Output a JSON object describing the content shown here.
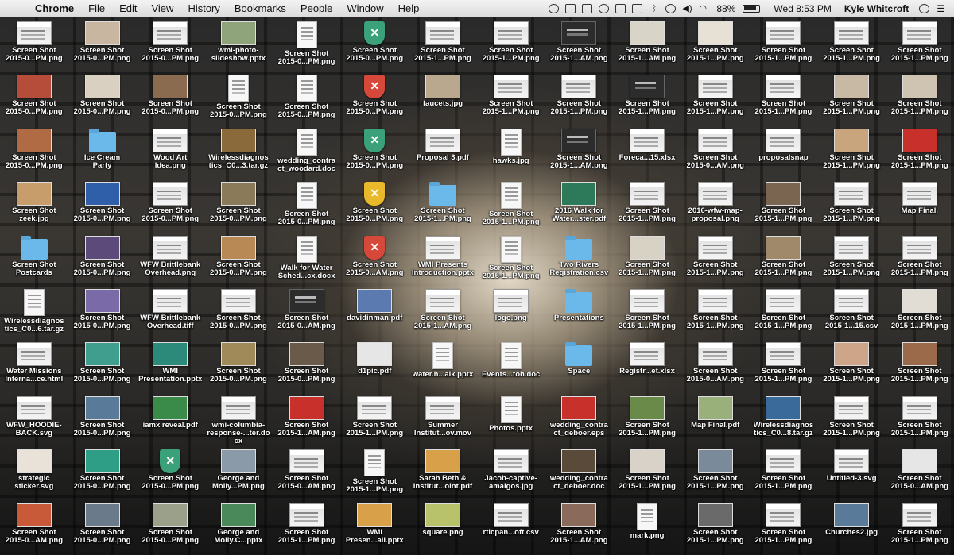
{
  "menubar": {
    "app_name": "Chrome",
    "menus": [
      "File",
      "Edit",
      "View",
      "History",
      "Bookmarks",
      "People",
      "Window",
      "Help"
    ],
    "battery": "88%",
    "clock": "Wed 8:53 PM",
    "user": "Kyle Whitcroft"
  },
  "desktop": {
    "rows": [
      [
        {
          "n1": "Screen Shot",
          "n2": "2015-0...PM.png",
          "t": "ss"
        },
        {
          "n1": "Screen Shot",
          "n2": "2015-0...PM.png",
          "t": "photo",
          "c": "#c9b6a0"
        },
        {
          "n1": "Screen Shot",
          "n2": "2015-0...PM.png",
          "t": "ss"
        },
        {
          "n1": "wmi-photo-",
          "n2": "slideshow.pptx",
          "t": "photo",
          "c": "#8fa47a"
        },
        {
          "n1": "Screen Shot",
          "n2": "2015-0...PM.png",
          "t": "doc"
        },
        {
          "n1": "Screen Shot",
          "n2": "2015-0...PM.png",
          "t": "shield",
          "c": "#3aa17a"
        },
        {
          "n1": "Screen Shot",
          "n2": "2015-1...PM.png",
          "t": "ss"
        },
        {
          "n1": "Screen Shot",
          "n2": "2015-1...PM.png",
          "t": "ss"
        },
        {
          "n1": "Screen Shot",
          "n2": "2015-1...AM.png",
          "t": "dark"
        },
        {
          "n1": "Screen Shot",
          "n2": "2015-1...AM.png",
          "t": "photo",
          "c": "#d9d4c8"
        },
        {
          "n1": "Screen Shot",
          "n2": "2015-1...PM.png",
          "t": "photo",
          "c": "#e6e0d5"
        },
        {
          "n1": "Screen Shot",
          "n2": "2015-1...PM.png",
          "t": "ss"
        },
        {
          "n1": "Screen Shot",
          "n2": "2015-1...PM.png",
          "t": "ss"
        },
        {
          "n1": "Screen Shot",
          "n2": "2015-1...PM.png",
          "t": "ss"
        }
      ],
      [
        {
          "n1": "Screen Shot",
          "n2": "2015-0...PM.png",
          "t": "photo",
          "c": "#b64c3a"
        },
        {
          "n1": "Screen Shot",
          "n2": "2015-0...PM.png",
          "t": "photo",
          "c": "#d9d0c2"
        },
        {
          "n1": "Screen Shot",
          "n2": "2015-0...PM.png",
          "t": "photo",
          "c": "#8a6b4f"
        },
        {
          "n1": "Screen Shot",
          "n2": "2015-0...PM.png",
          "t": "doc"
        },
        {
          "n1": "Screen Shot",
          "n2": "2015-0...PM.png",
          "t": "doc"
        },
        {
          "n1": "Screen Shot",
          "n2": "2015-0...PM.png",
          "t": "shield",
          "c": "#d6493a"
        },
        {
          "n1": "faucets.jpg",
          "n2": "",
          "t": "photo",
          "c": "#b9a88d"
        },
        {
          "n1": "Screen Shot",
          "n2": "2015-1...PM.png",
          "t": "ss"
        },
        {
          "n1": "Screen Shot",
          "n2": "2015-1...PM.png",
          "t": "ss"
        },
        {
          "n1": "Screen Shot",
          "n2": "2015-1...PM.png",
          "t": "dark"
        },
        {
          "n1": "Screen Shot",
          "n2": "2015-1...PM.png",
          "t": "ss"
        },
        {
          "n1": "Screen Shot",
          "n2": "2015-1...PM.png",
          "t": "ss"
        },
        {
          "n1": "Screen Shot",
          "n2": "2015-1...PM.png",
          "t": "photo",
          "c": "#c7b9a3"
        },
        {
          "n1": "Screen Shot",
          "n2": "2015-1...PM.png",
          "t": "photo",
          "c": "#cfc3b1"
        }
      ],
      [
        {
          "n1": "Screen Shot",
          "n2": "2015-0...PM.png",
          "t": "photo",
          "c": "#b06b45"
        },
        {
          "n1": "Ice Cream",
          "n2": "Party",
          "t": "folder"
        },
        {
          "n1": "Wood Art",
          "n2": "Idea.png",
          "t": "ss"
        },
        {
          "n1": "Wirelessdiagnos",
          "n2": "tics_C0...3.tar.gz",
          "t": "photo",
          "c": "#8a6a3a"
        },
        {
          "n1": "wedding_contra",
          "n2": "ct_woodard.doc",
          "t": "doc"
        },
        {
          "n1": "Screen Shot",
          "n2": "2015-0...PM.png",
          "t": "shield",
          "c": "#3aa17a"
        },
        {
          "n1": "Proposal 3.pdf",
          "n2": "",
          "t": "ss"
        },
        {
          "n1": "hawks.jpg",
          "n2": "",
          "t": "doc"
        },
        {
          "n1": "Screen Shot",
          "n2": "2015-1...AM.png",
          "t": "dark"
        },
        {
          "n1": "Foreca...15.xlsx",
          "n2": "",
          "t": "ss"
        },
        {
          "n1": "Screen Shot",
          "n2": "2015-0...AM.png",
          "t": "ss"
        },
        {
          "n1": "proposalsnap",
          "n2": "",
          "t": "ss"
        },
        {
          "n1": "Screen Shot",
          "n2": "2015-1...PM.png",
          "t": "photo",
          "c": "#c9a57e"
        },
        {
          "n1": "Screen Shot",
          "n2": "2015-1...PM.png",
          "t": "photo",
          "c": "#c8302c"
        }
      ],
      [
        {
          "n1": "Screen Shot",
          "n2": "zeek.jpg",
          "t": "photo",
          "c": "#c79d6b"
        },
        {
          "n1": "Screen Shot",
          "n2": "2015-0...PM.png",
          "t": "photo",
          "c": "#2f5fa8"
        },
        {
          "n1": "Screen Shot",
          "n2": "2015-0...PM.png",
          "t": "ss"
        },
        {
          "n1": "Screen Shot",
          "n2": "2015-0...PM.png",
          "t": "photo",
          "c": "#8a7a5a"
        },
        {
          "n1": "Screen Shot",
          "n2": "2015-0...PM.png",
          "t": "doc"
        },
        {
          "n1": "Screen Shot",
          "n2": "2015-0...PM.png",
          "t": "shield",
          "c": "#e8b92a"
        },
        {
          "n1": "Screen Shot",
          "n2": "2015-1...PM.png",
          "t": "folder"
        },
        {
          "n1": "Screen Shot",
          "n2": "2015-1...PM.png",
          "t": "doc"
        },
        {
          "n1": "2016 Walk for",
          "n2": "Water...ster.pdf",
          "t": "photo",
          "c": "#2c7a5a"
        },
        {
          "n1": "Screen Shot",
          "n2": "2015-1...PM.png",
          "t": "ss"
        },
        {
          "n1": "2016-wfw-map-",
          "n2": "proposal.png",
          "t": "ss"
        },
        {
          "n1": "Screen Shot",
          "n2": "2015-1...PM.png",
          "t": "photo",
          "c": "#7a6650"
        },
        {
          "n1": "Screen Shot",
          "n2": "2015-1...PM.png",
          "t": "ss"
        },
        {
          "n1": "Map Final.",
          "n2": "",
          "t": "ss"
        }
      ],
      [
        {
          "n1": "Screen Shot",
          "n2": "Postcards",
          "t": "folder"
        },
        {
          "n1": "Screen Shot",
          "n2": "2015-0...PM.png",
          "t": "photo",
          "c": "#5b4a7a"
        },
        {
          "n1": "WFW Brittlebank",
          "n2": "Overhead.png",
          "t": "ss"
        },
        {
          "n1": "Screen Shot",
          "n2": "2015-0...PM.png",
          "t": "photo",
          "c": "#b98955"
        },
        {
          "n1": "Walk for Water",
          "n2": "Sched...cx.docx",
          "t": "doc"
        },
        {
          "n1": "Screen Shot",
          "n2": "2015-0...AM.png",
          "t": "shield",
          "c": "#d6493a"
        },
        {
          "n1": "WMI Presents",
          "n2": "Introduction.pptx",
          "t": "ss"
        },
        {
          "n1": "Screen Shot",
          "n2": "2015-1...PM.png",
          "t": "doc"
        },
        {
          "n1": "Two Rivers",
          "n2": "Registration.csv",
          "t": "folder"
        },
        {
          "n1": "Screen Shot",
          "n2": "2015-1...PM.png",
          "t": "photo",
          "c": "#d8d2c4"
        },
        {
          "n1": "Screen Shot",
          "n2": "2015-1...PM.png",
          "t": "ss"
        },
        {
          "n1": "Screen Shot",
          "n2": "2015-1...PM.png",
          "t": "photo",
          "c": "#a0886a"
        },
        {
          "n1": "Screen Shot",
          "n2": "2015-1...PM.png",
          "t": "ss"
        },
        {
          "n1": "Screen Shot",
          "n2": "2015-1...PM.png",
          "t": "ss"
        }
      ],
      [
        {
          "n1": "Wirelessdiagnos",
          "n2": "tics_C0...6.tar.gz",
          "t": "doc"
        },
        {
          "n1": "Screen Shot",
          "n2": "2015-0...PM.png",
          "t": "photo",
          "c": "#7a6aa8"
        },
        {
          "n1": "WFW Brittlebank",
          "n2": "Overhead.tiff",
          "t": "ss"
        },
        {
          "n1": "Screen Shot",
          "n2": "2015-0...PM.png",
          "t": "ss"
        },
        {
          "n1": "Screen Shot",
          "n2": "2015-0...AM.png",
          "t": "dark"
        },
        {
          "n1": "davidinman.pdf",
          "n2": "",
          "t": "photo",
          "c": "#5a7ab0"
        },
        {
          "n1": "Screen Shot",
          "n2": "2015-1...AM.png",
          "t": "ss"
        },
        {
          "n1": "logo.png",
          "n2": "",
          "t": "ss"
        },
        {
          "n1": "Presentations",
          "n2": "",
          "t": "folder"
        },
        {
          "n1": "Screen Shot",
          "n2": "2015-1...PM.png",
          "t": "ss"
        },
        {
          "n1": "Screen Shot",
          "n2": "2015-1...PM.png",
          "t": "ss"
        },
        {
          "n1": "Screen Shot",
          "n2": "2015-1...PM.png",
          "t": "ss"
        },
        {
          "n1": "Screen Shot",
          "n2": "2015-1...15.csv",
          "t": "ss"
        },
        {
          "n1": "Screen Shot",
          "n2": "2015-1...PM.png",
          "t": "photo",
          "c": "#e2ddd4"
        }
      ],
      [
        {
          "n1": "Water Missions",
          "n2": "Interna...ce.html",
          "t": "ss"
        },
        {
          "n1": "Screen Shot",
          "n2": "2015-0...PM.png",
          "t": "photo",
          "c": "#3f9e8e"
        },
        {
          "n1": "WMI",
          "n2": "Presentation.pptx",
          "t": "photo",
          "c": "#2b8a7a"
        },
        {
          "n1": "Screen Shot",
          "n2": "2015-0...PM.png",
          "t": "photo",
          "c": "#a08a5a"
        },
        {
          "n1": "Screen Shot",
          "n2": "2015-0...PM.png",
          "t": "photo",
          "c": "#6a5a4a"
        },
        {
          "n1": "d1pic.pdf",
          "n2": "",
          "t": "photo",
          "c": "#e6e6e6"
        },
        {
          "n1": "water.h...alk.pptx",
          "n2": "",
          "t": "doc"
        },
        {
          "n1": "Events...toh.doc",
          "n2": "",
          "t": "doc"
        },
        {
          "n1": "Space",
          "n2": "",
          "t": "folder"
        },
        {
          "n1": "Registr...et.xlsx",
          "n2": "",
          "t": "ss"
        },
        {
          "n1": "Screen Shot",
          "n2": "2015-0...AM.png",
          "t": "ss"
        },
        {
          "n1": "Screen Shot",
          "n2": "2015-1...PM.png",
          "t": "ss"
        },
        {
          "n1": "Screen Shot",
          "n2": "2015-1...PM.png",
          "t": "photo",
          "c": "#cfa58a"
        },
        {
          "n1": "Screen Shot",
          "n2": "2015-1...PM.png",
          "t": "photo",
          "c": "#9a6a4a"
        }
      ],
      [
        {
          "n1": "WFW_HOODIE-",
          "n2": "BACK.svg",
          "t": "ss"
        },
        {
          "n1": "Screen Shot",
          "n2": "2015-0...PM.png",
          "t": "photo",
          "c": "#5a7a9a"
        },
        {
          "n1": "iamx reveal.pdf",
          "n2": "",
          "t": "photo",
          "c": "#3a8a4a"
        },
        {
          "n1": "wmi-columbia-",
          "n2": "response-...ter.docx",
          "t": "ss"
        },
        {
          "n1": "Screen Shot",
          "n2": "2015-1...AM.png",
          "t": "photo",
          "c": "#c8302c"
        },
        {
          "n1": "Screen Shot",
          "n2": "2015-1...PM.png",
          "t": "ss"
        },
        {
          "n1": "Summer",
          "n2": "Institut...ov.mov",
          "t": "ss"
        },
        {
          "n1": "Photos.pptx",
          "n2": "",
          "t": "doc"
        },
        {
          "n1": "wedding_contra",
          "n2": "ct_deboer.eps",
          "t": "photo",
          "c": "#c8302c"
        },
        {
          "n1": "Screen Shot",
          "n2": "2015-1...PM.png",
          "t": "photo",
          "c": "#6a8a4a"
        },
        {
          "n1": "Map Final.pdf",
          "n2": "",
          "t": "photo",
          "c": "#9ab07a"
        },
        {
          "n1": "Wirelessdiagnos",
          "n2": "tics_C0...8.tar.gz",
          "t": "photo",
          "c": "#3a6a9a"
        },
        {
          "n1": "Screen Shot",
          "n2": "2015-1...PM.png",
          "t": "ss"
        },
        {
          "n1": "Screen Shot",
          "n2": "2015-1...PM.png",
          "t": "ss"
        }
      ],
      [
        {
          "n1": "strategic",
          "n2": "sticker.svg",
          "t": "photo",
          "c": "#e8e2d8"
        },
        {
          "n1": "Screen Shot",
          "n2": "2015-0...PM.png",
          "t": "photo",
          "c": "#2f9e86"
        },
        {
          "n1": "Screen Shot",
          "n2": "2015-0...PM.png",
          "t": "shield",
          "c": "#3aa17a"
        },
        {
          "n1": "George and",
          "n2": "Molly...PM.png",
          "t": "photo",
          "c": "#8a9aa8"
        },
        {
          "n1": "Screen Shot",
          "n2": "2015-0...AM.png",
          "t": "ss"
        },
        {
          "n1": "Screen Shot",
          "n2": "2015-1...PM.png",
          "t": "doc"
        },
        {
          "n1": "Sarah Beth &",
          "n2": "Institut...oint.pdf",
          "t": "photo",
          "c": "#d9a04a"
        },
        {
          "n1": "Jacob-captive-",
          "n2": "amalgos.jpg",
          "t": "ss"
        },
        {
          "n1": "wedding_contra",
          "n2": "ct_deboer.doc",
          "t": "photo",
          "c": "#5a4a3a"
        },
        {
          "n1": "Screen Shot",
          "n2": "2015-1...PM.png",
          "t": "photo",
          "c": "#d8d2c8"
        },
        {
          "n1": "Screen Shot",
          "n2": "2015-1...PM.png",
          "t": "photo",
          "c": "#7a8a9a"
        },
        {
          "n1": "Screen Shot",
          "n2": "2015-1...PM.png",
          "t": "ss"
        },
        {
          "n1": "Untitled-3.svg",
          "n2": "",
          "t": "ss"
        },
        {
          "n1": "Screen Shot",
          "n2": "2015-0...AM.png",
          "t": "photo",
          "c": "#e6e6e6"
        }
      ],
      [
        {
          "n1": "Screen Shot",
          "n2": "2015-0...AM.png",
          "t": "photo",
          "c": "#c85a3a"
        },
        {
          "n1": "Screen Shot",
          "n2": "2015-0...PM.png",
          "t": "photo",
          "c": "#6a7a8a"
        },
        {
          "n1": "Screen Shot",
          "n2": "2015-0...PM.png",
          "t": "photo",
          "c": "#9aa08a"
        },
        {
          "n1": "George and",
          "n2": "Molly.C...pptx",
          "t": "photo",
          "c": "#4a8a5a"
        },
        {
          "n1": "Screen Shot",
          "n2": "2015-1...PM.png",
          "t": "ss"
        },
        {
          "n1": "WMI",
          "n2": "Presen...ail.pptx",
          "t": "photo",
          "c": "#d9a04a"
        },
        {
          "n1": "square.png",
          "n2": "",
          "t": "photo",
          "c": "#b8c26a"
        },
        {
          "n1": "rticpan...oft.csv",
          "n2": "",
          "t": "ss"
        },
        {
          "n1": "Screen Shot",
          "n2": "2015-1...AM.png",
          "t": "photo",
          "c": "#8a6a5a"
        },
        {
          "n1": "mark.png",
          "n2": "",
          "t": "doc"
        },
        {
          "n1": "Screen Shot",
          "n2": "2015-1...PM.png",
          "t": "photo",
          "c": "#6a6a6a"
        },
        {
          "n1": "Screen Shot",
          "n2": "2015-1...PM.png",
          "t": "ss"
        },
        {
          "n1": "Churches2.jpg",
          "n2": "",
          "t": "photo",
          "c": "#5a7a9a"
        },
        {
          "n1": "Screen Shot",
          "n2": "2015-1...PM.png",
          "t": "ss"
        }
      ]
    ]
  }
}
